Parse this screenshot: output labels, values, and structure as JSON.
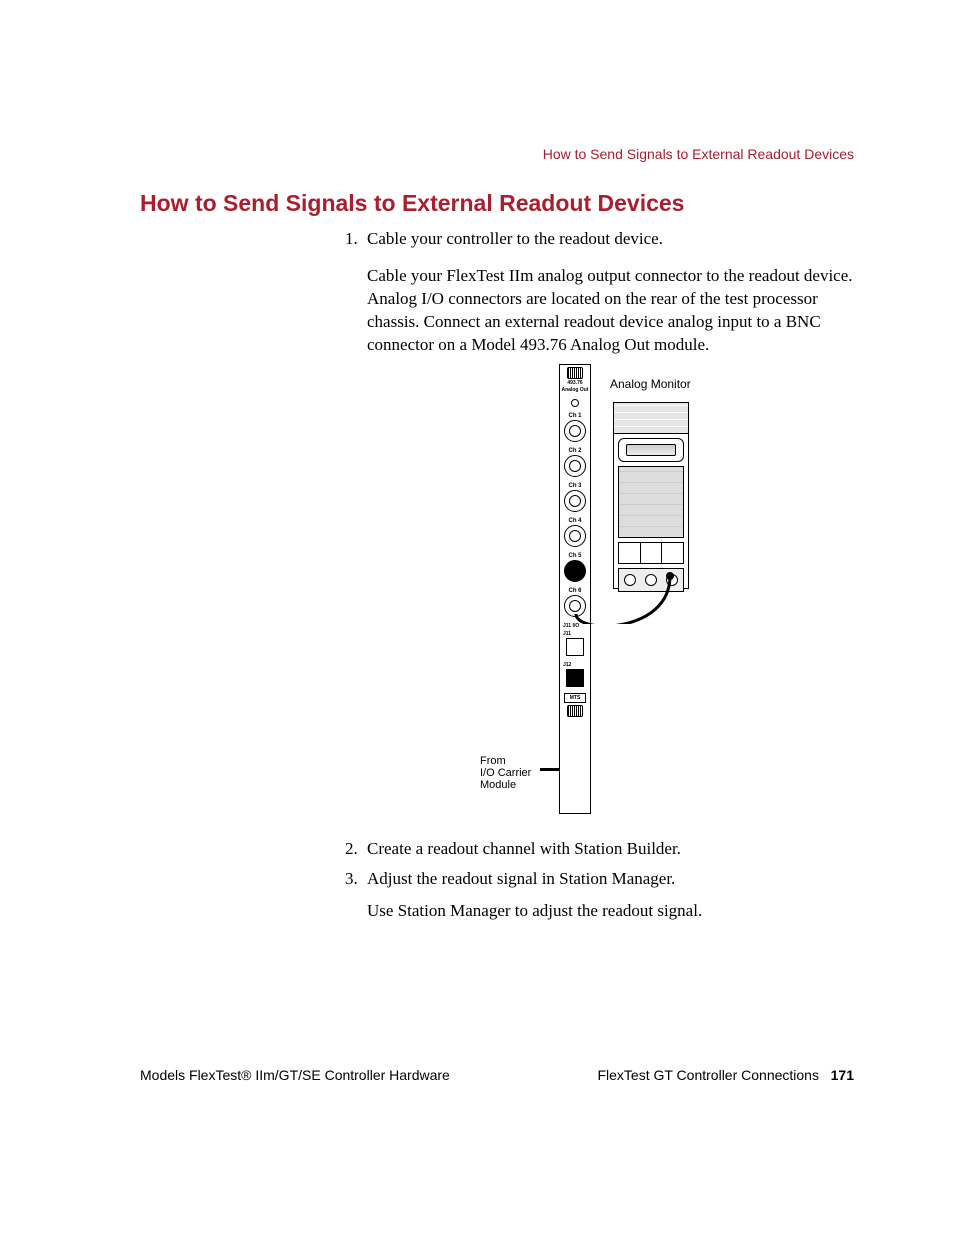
{
  "running_head": "How to Send Signals to External Readout Devices",
  "heading": "How to Send Signals to External Readout Devices",
  "steps": {
    "s1_num": "1.",
    "s1_text": "Cable your controller to the readout device.",
    "s1_para": "Cable your FlexTest IIm analog output connector to the readout device. Analog I/O connectors are located on the rear of the test processor chassis. Connect an external readout device analog input to a BNC connector on a Model 493.76 Analog Out module.",
    "s2_num": "2.",
    "s2_text": "Create a readout channel with Station Builder.",
    "s3_num": "3.",
    "s3_text": "Adjust the readout signal in Station Manager.",
    "s3_para": "Use Station Manager to adjust the readout signal."
  },
  "diagram": {
    "analog_monitor": "Analog Monitor",
    "from_label_l1": "From",
    "from_label_l2": "I/O Carrier",
    "from_label_l3": "Module",
    "module": {
      "title1": "493.76",
      "title2": "Analog Out",
      "ch1": "Ch 1",
      "ch2": "Ch 2",
      "ch3": "Ch 3",
      "ch4": "Ch 4",
      "ch5": "Ch 5",
      "ch6": "Ch 6",
      "j_io": "J11 I/O",
      "j11": "J11",
      "j12": "J12",
      "mts": "MTS"
    }
  },
  "footer": {
    "left": "Models FlexTest® IIm/GT/SE Controller Hardware",
    "right_text": "FlexTest GT Controller Connections",
    "page": "171"
  }
}
